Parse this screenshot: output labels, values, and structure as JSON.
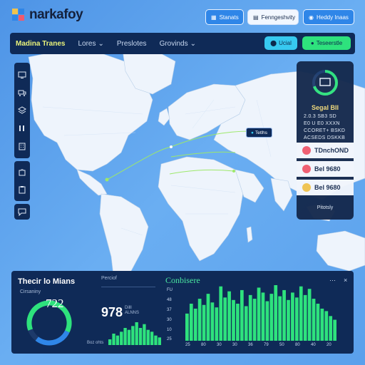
{
  "app": {
    "brand": "narkafoy"
  },
  "topbar": {
    "buttons": [
      {
        "label": "Stanats",
        "icon": "grid-icon"
      },
      {
        "label": "Fenngeshvity",
        "icon": "calendar-icon"
      },
      {
        "label": "Heddy Inaas",
        "icon": "bell-icon"
      }
    ]
  },
  "nav": {
    "items": [
      {
        "label": "Madina Tranes",
        "active": true
      },
      {
        "label": "Lores",
        "has_menu": true
      },
      {
        "label": "Preslotes",
        "has_menu": false
      },
      {
        "label": "Grovinds",
        "has_menu": true
      }
    ],
    "chips": [
      {
        "label": "Ucial",
        "color": "#37c9f0"
      },
      {
        "label": "Teseerstle",
        "color": "#2ee27d"
      }
    ]
  },
  "sidebar": {
    "group1": [
      "monitor-icon",
      "truck-icon",
      "layers-icon",
      "columns-icon",
      "building-icon"
    ],
    "group2": [
      "puzzle-icon",
      "clipboard-icon"
    ],
    "group3": [
      "chat-icon"
    ]
  },
  "map": {
    "callout": {
      "label": "Tetlhs"
    }
  },
  "right_panel": {
    "title": "Segal BII",
    "lines": [
      "2.0.3 SB3 SD",
      "E0 U E0 XXXN",
      "CCORET+ BSKD",
      "ACSEDS DSKKB"
    ],
    "rows": [
      {
        "value": "TDnchOND",
        "color": "#f05a6e",
        "icon": "alert-icon"
      },
      {
        "value": "Bel 9680",
        "color": "#f05a6e",
        "icon": "block-icon"
      },
      {
        "value": "Bel 9680",
        "color": "#f0c34e",
        "icon": "sun-icon"
      }
    ],
    "footer": "Pitotsly"
  },
  "bottom": {
    "title": "Thecir lo Mians",
    "subtitle": "Cirsaniny",
    "gauge_value": "722",
    "stat_label": "Perciof",
    "stat_value": "978",
    "stat_sub": [
      "Dilll",
      "ALNNS"
    ],
    "stat_foot": "Boz ohts",
    "chart_title": "Conbisere",
    "y_ticks": [
      "FU",
      "48",
      "37",
      "30",
      "10",
      "25"
    ],
    "x_ticks": [
      "25",
      "80",
      "30",
      "30",
      "36",
      "79",
      "50",
      "80",
      "40",
      "20"
    ]
  },
  "chart_data": [
    {
      "type": "bar",
      "title": "",
      "values": [
        3,
        6,
        5,
        7,
        9,
        8,
        10,
        12,
        9,
        11,
        8,
        7,
        5,
        4
      ],
      "color": "#2ee27d"
    },
    {
      "type": "bar",
      "title": "Conbisere",
      "values": [
        22,
        30,
        26,
        34,
        29,
        38,
        31,
        27,
        44,
        35,
        40,
        33,
        30,
        41,
        28,
        37,
        34,
        43,
        39,
        32,
        38,
        45,
        36,
        41,
        33,
        39,
        35,
        44,
        37,
        42,
        34,
        30,
        26,
        24,
        20,
        17
      ],
      "color": "#2ee27d",
      "y_ticks": [
        "FU",
        "48",
        "37",
        "30",
        "10",
        "25"
      ],
      "x_ticks": [
        "25",
        "80",
        "30",
        "30",
        "36",
        "79",
        "50",
        "80",
        "40",
        "20"
      ]
    }
  ]
}
